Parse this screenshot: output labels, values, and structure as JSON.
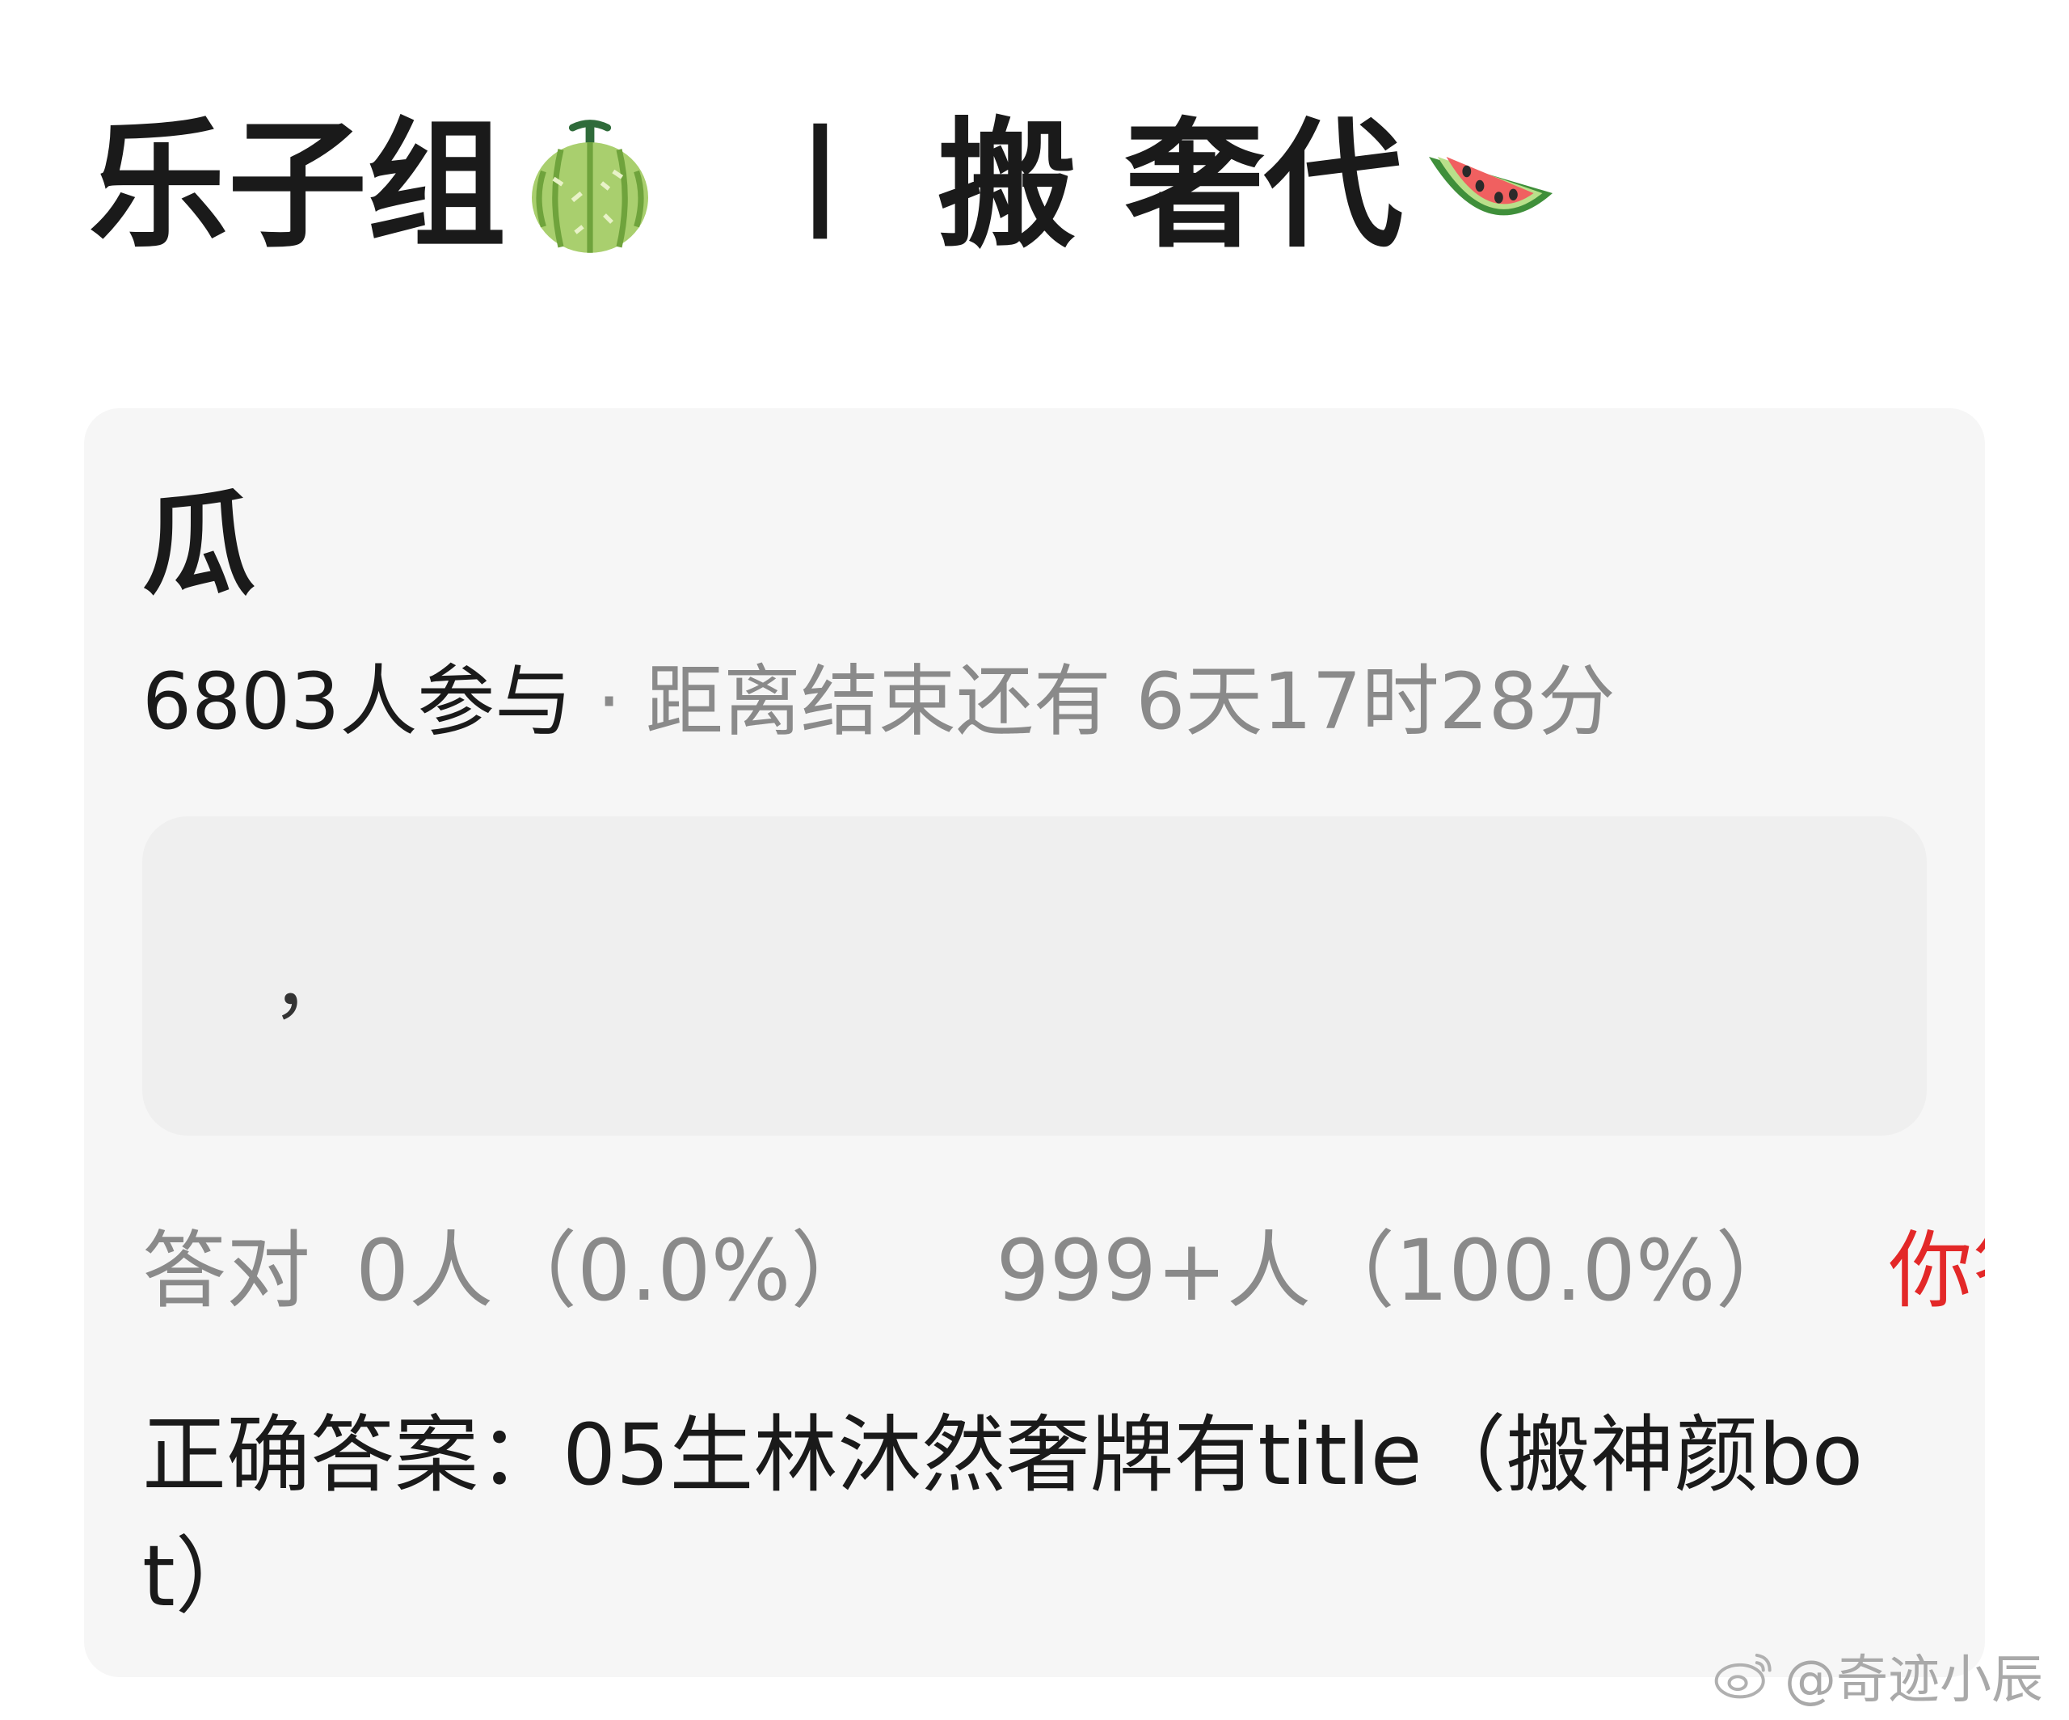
{
  "header": {
    "group_name": "乐子组",
    "separator": "丨",
    "topic": "搬 奢代",
    "left_emoji": "melon-icon",
    "right_emoji": "watermelon-icon"
  },
  "card": {
    "title": "瓜",
    "participants": "6803人参与",
    "dot": "·",
    "countdown": "距离结束还有 6天17时28分",
    "answer_box_text": "，",
    "stats": {
      "correct_label": "答对",
      "correct_count": "0人（0.0%）",
      "wrong_count": "999+人（100.0%）",
      "your_result": "你答错了"
    },
    "correct_answer": "正确答案：05生林沐然奢牌有title（搬神颜bot）"
  },
  "watermark": {
    "text": "@奇迹小辰",
    "icon": "weibo-icon"
  },
  "colors": {
    "card_bg": "#f6f6f6",
    "answer_box_bg": "#efefef",
    "muted_text": "#8a8a8a",
    "wrong_red": "#e32828"
  }
}
